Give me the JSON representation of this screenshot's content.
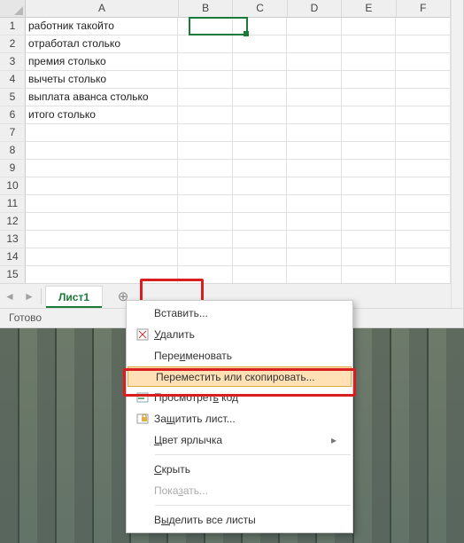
{
  "chart_data": {
    "type": "table",
    "columns": [
      "A",
      "B",
      "C",
      "D",
      "E",
      "F"
    ],
    "rows": [
      [
        "работник такойто",
        "",
        "",
        "",
        "",
        ""
      ],
      [
        "отработал столько",
        "",
        "",
        "",
        "",
        ""
      ],
      [
        "премия столько",
        "",
        "",
        "",
        "",
        ""
      ],
      [
        "вычеты столько",
        "",
        "",
        "",
        "",
        ""
      ],
      [
        "выплата аванса столько",
        "",
        "",
        "",
        "",
        ""
      ],
      [
        "итого столько",
        "",
        "",
        "",
        "",
        ""
      ]
    ]
  },
  "columns": {
    "A": "A",
    "B": "B",
    "C": "C",
    "D": "D",
    "E": "E",
    "F": "F"
  },
  "rows": [
    "1",
    "2",
    "3",
    "4",
    "5",
    "6",
    "7",
    "8",
    "9",
    "10",
    "11",
    "12",
    "13",
    "14",
    "15"
  ],
  "cells": {
    "a1": "работник такойто",
    "a2": "отработал столько",
    "a3": "премия столько",
    "a4": "вычеты столько",
    "a5": "выплата аванса столько",
    "a6": "итого столько"
  },
  "sheet": {
    "tab": "Лист1"
  },
  "status": {
    "ready": "Готово"
  },
  "menu": {
    "insert": "Вставить...",
    "delete": "Удалить",
    "rename": "Переименовать",
    "move": "Переместить или скопировать...",
    "viewcode": "Просмотреть код",
    "protect": "Защитить лист...",
    "tabcolor": "Цвет ярлычка",
    "hide": "Скрыть",
    "unhide": "Показать...",
    "selectall": "Выделить все листы"
  },
  "access": {
    "delete_u": "У",
    "delete_rest": "далить",
    "rename_pre": "Пере",
    "rename_u": "и",
    "rename_post": "меновать",
    "viewcode_pre": "Просмотрет",
    "viewcode_u": "ь",
    "viewcode_post": " код",
    "protect_pre": "За",
    "protect_u": "щ",
    "protect_post": "итить лист...",
    "tabcolor_pre": "",
    "tabcolor_u": "Ц",
    "tabcolor_post": "вет ярлычка",
    "hide_pre": "",
    "hide_u": "С",
    "hide_post": "крыть",
    "unhide_pre": "Пока",
    "unhide_u": "з",
    "unhide_post": "ать...",
    "selectall_pre": "В",
    "selectall_u": "ы",
    "selectall_post": "делить все листы"
  }
}
